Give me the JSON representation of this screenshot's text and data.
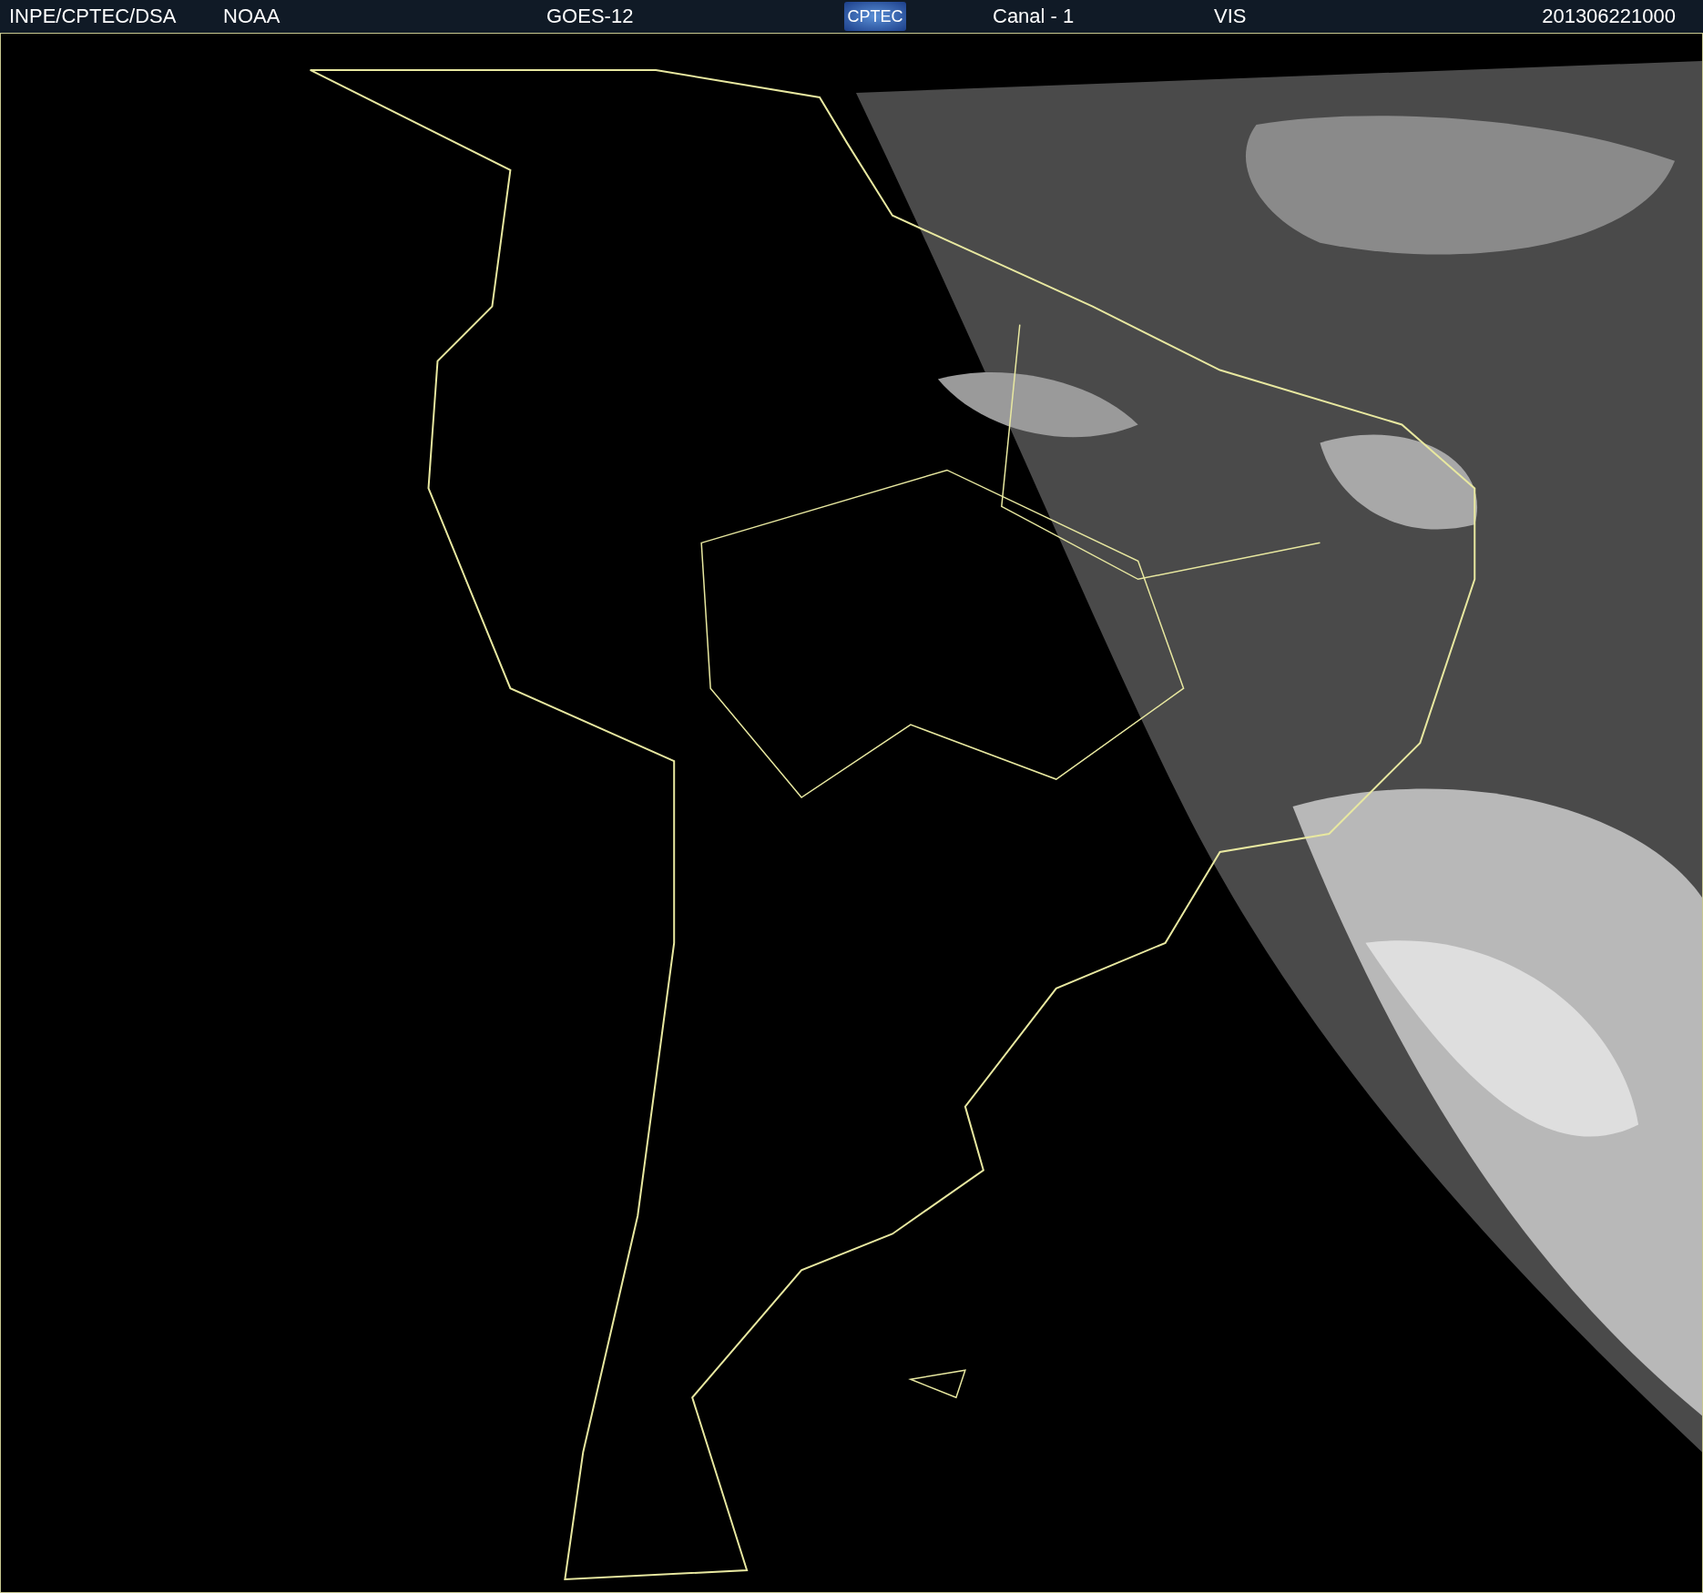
{
  "header": {
    "agency": "INPE/CPTEC/DSA",
    "operator": "NOAA",
    "satellite": "GOES-12",
    "logo_text": "CPTEC",
    "channel": "Canal - 1",
    "band": "VIS",
    "timestamp": "201306221000"
  }
}
